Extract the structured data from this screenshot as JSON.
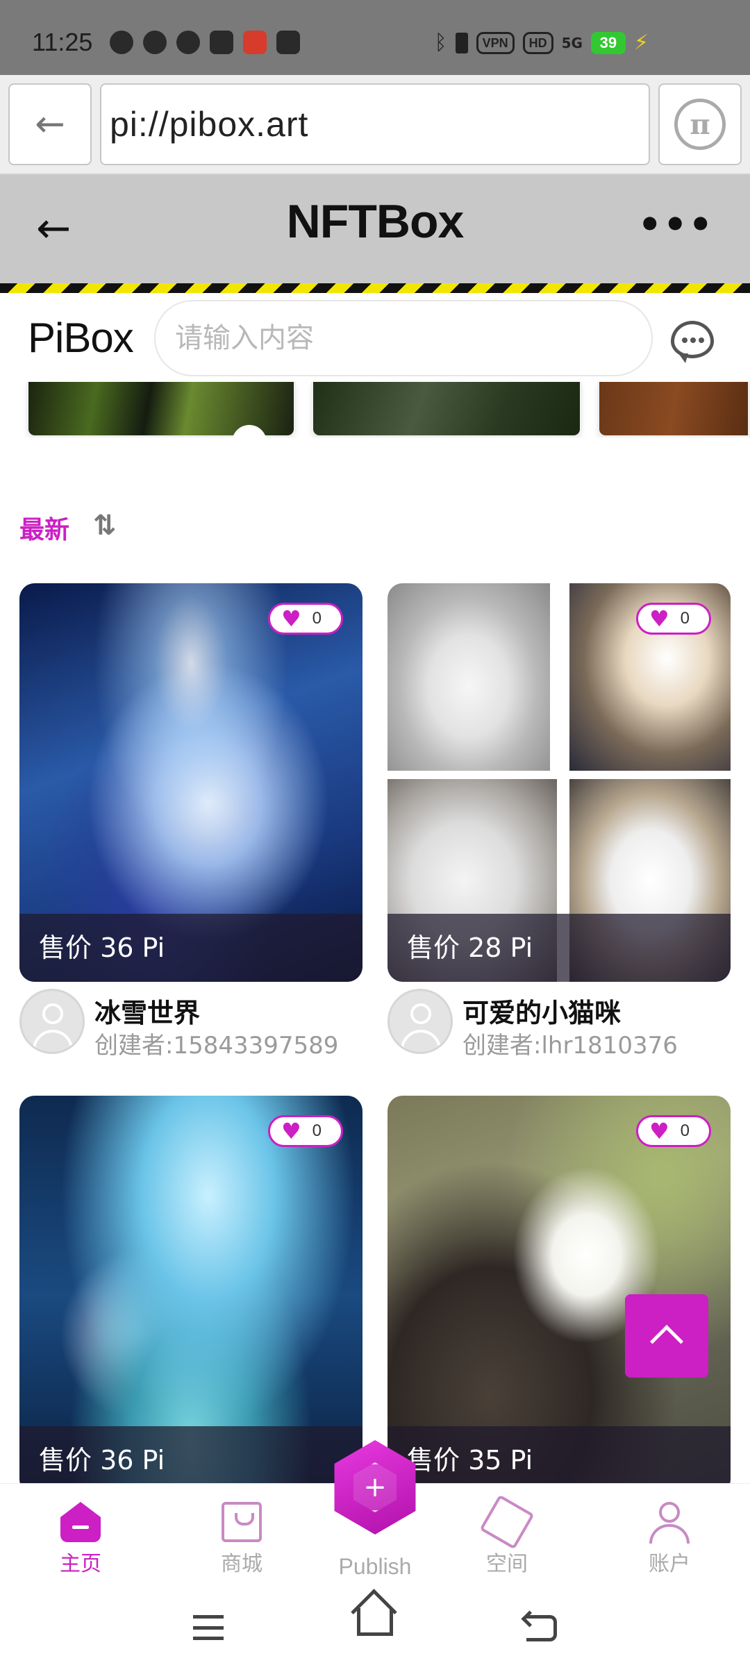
{
  "status_bar": {
    "time": "11:25",
    "vpn": "VPN",
    "hd": "HD",
    "network": "5G",
    "battery": "39"
  },
  "browser": {
    "url": "pi://pibox.art",
    "back_icon": "arrow-left-icon",
    "pi_icon": "pi-logo-icon"
  },
  "header": {
    "title": "NFTBox",
    "back_icon": "arrow-left-icon",
    "more_icon": "more-dots-icon"
  },
  "search": {
    "brand": "PiBox",
    "placeholder": "请输入内容",
    "chat_icon": "chat-bubble-icon"
  },
  "sort": {
    "label": "最新",
    "icon": "sort-arrows-icon"
  },
  "cards": [
    {
      "title": "冰雪世界",
      "creator": "创建者:15843397589",
      "price": "售价 36 Pi",
      "likes": "0"
    },
    {
      "title": "可爱的小猫咪",
      "creator": "创建者:lhr1810376",
      "price": "售价 28 Pi",
      "likes": "0"
    },
    {
      "title": "",
      "creator": "",
      "price": "售价 36 Pi",
      "likes": "0"
    },
    {
      "title": "",
      "creator": "",
      "price": "售价 35 Pi",
      "likes": "0"
    }
  ],
  "bottom_nav": {
    "items": [
      {
        "label": "主页",
        "icon": "home-icon",
        "active": true
      },
      {
        "label": "商城",
        "icon": "shopping-bag-icon",
        "active": false
      },
      {
        "label": "Publish",
        "icon": "publish-plus-icon",
        "active": false
      },
      {
        "label": "空间",
        "icon": "cube-icon",
        "active": false
      },
      {
        "label": "账户",
        "icon": "user-icon",
        "active": false
      }
    ]
  },
  "colors": {
    "accent": "#cc1fc4",
    "header_bg": "#c8c8c8",
    "status_bg": "#7a7a7a"
  }
}
